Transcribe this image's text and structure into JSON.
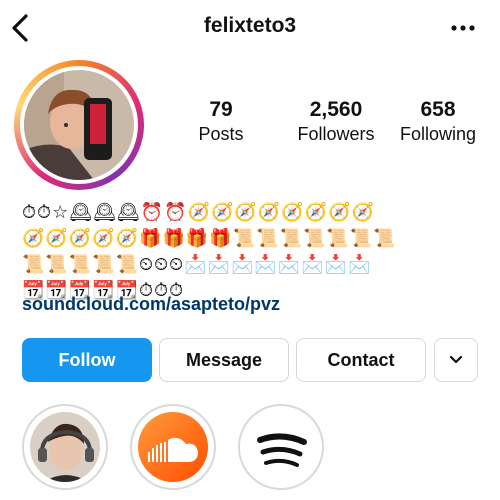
{
  "header": {
    "username": "felixteto3"
  },
  "stats": [
    {
      "value": "79",
      "label": "Posts"
    },
    {
      "value": "2,560",
      "label": "Followers"
    },
    {
      "value": "658",
      "label": "Following"
    }
  ],
  "bio": {
    "emoji_rows": [
      "⏱⏱☆🕰🕰🕰⏰⏰🧭🧭🧭🧭🧭🧭🧭🧭",
      "🧭🧭🧭🧭🧭🎁🎁🎁🎁📜📜📜📜📜📜📜",
      "📜📜📜📜📜⏲⏲⏲📩📩📩📩📩📩📩📩",
      "📆📆📆📆📆⏱⏱⏱"
    ],
    "link": "soundcloud.com/asapteto/pvz"
  },
  "actions": {
    "follow": "Follow",
    "message": "Message",
    "contact": "Contact"
  },
  "highlights": [
    {
      "icon": "portrait-icon"
    },
    {
      "icon": "soundcloud-icon"
    },
    {
      "icon": "spotify-icon"
    }
  ]
}
